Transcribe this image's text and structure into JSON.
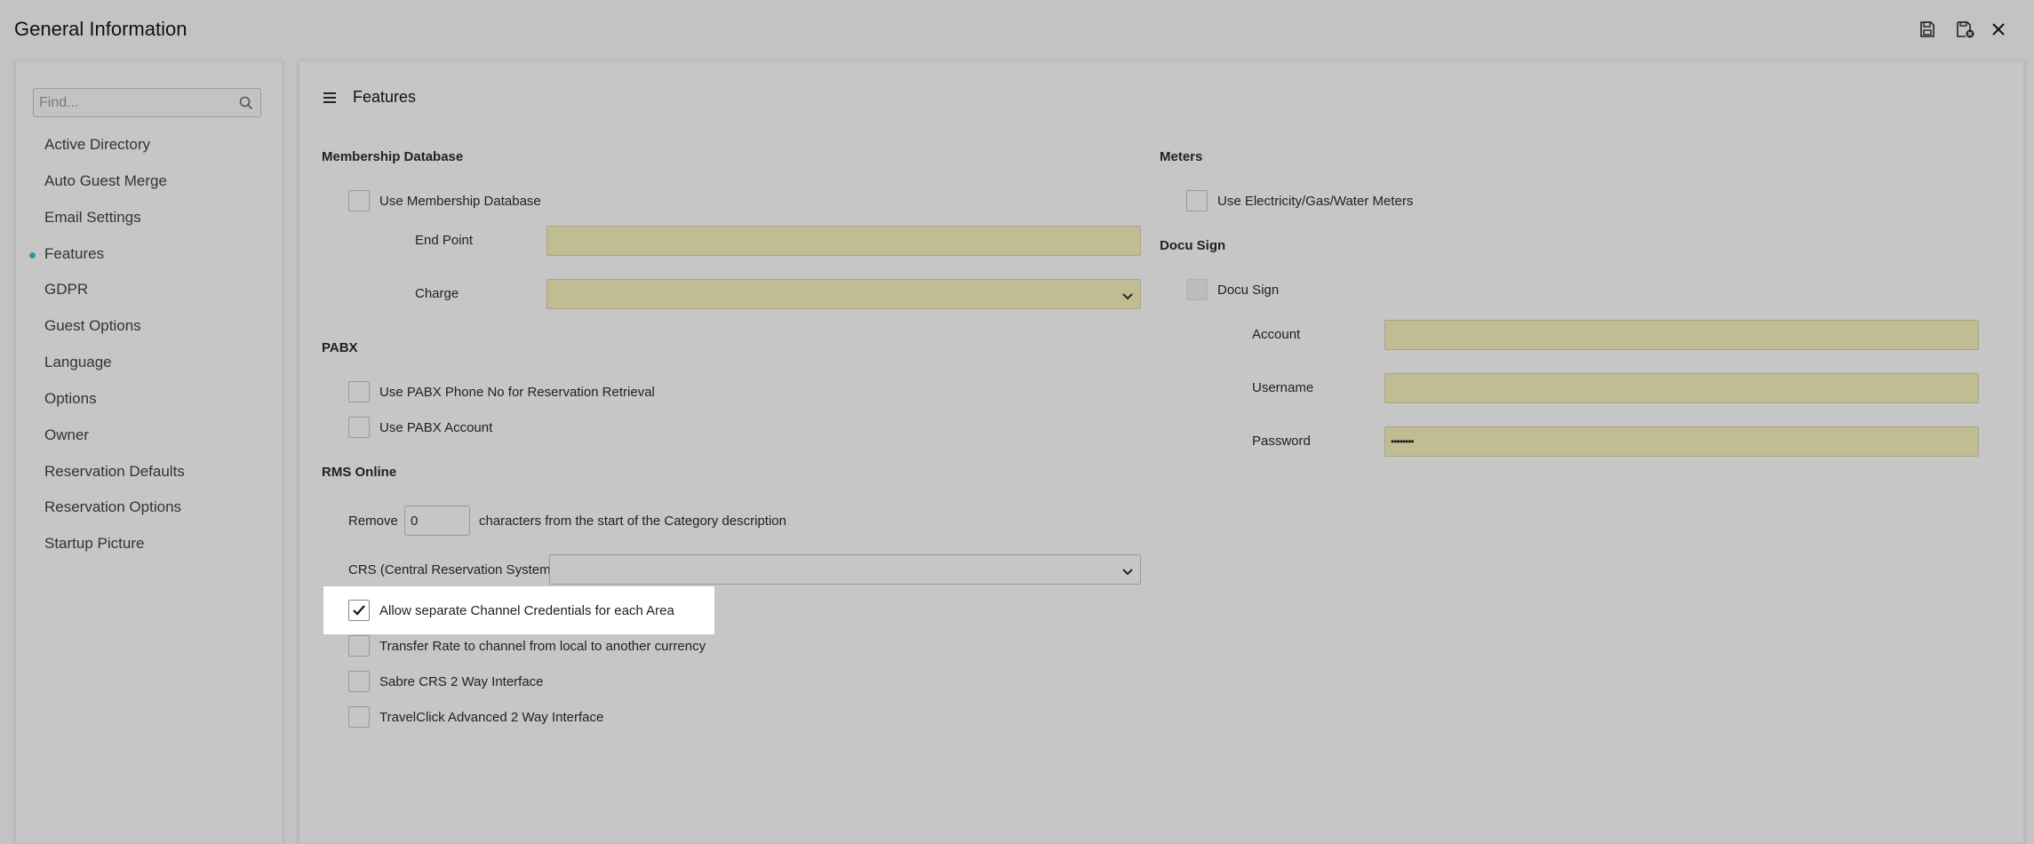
{
  "window": {
    "title": "General Information"
  },
  "toolbar": {
    "save_icon": "save-icon",
    "save_close_icon": "save-close-icon",
    "close_icon": "close-icon"
  },
  "sidebar": {
    "search_placeholder": "Find...",
    "active": "Features",
    "items": [
      "Active Directory",
      "Auto Guest Merge",
      "Email Settings",
      "Features",
      "GDPR",
      "Guest Options",
      "Language",
      "Options",
      "Owner",
      "Reservation Defaults",
      "Reservation Options",
      "Startup Picture"
    ]
  },
  "main": {
    "title": "Features",
    "membership": {
      "heading": "Membership Database",
      "use_label": "Use Membership Database",
      "use_checked": false,
      "end_point_label": "End Point",
      "end_point_value": "",
      "charge_label": "Charge",
      "charge_value": ""
    },
    "pabx": {
      "heading": "PABX",
      "phone_label": "Use PABX Phone No for Reservation Retrieval",
      "phone_checked": false,
      "account_label": "Use PABX Account",
      "account_checked": false
    },
    "rms_online": {
      "heading": "RMS Online",
      "remove_label": "Remove",
      "remove_value": "0",
      "remove_suffix": "characters from the start of the Category description",
      "crs_label": "CRS (Central Reservation System)",
      "crs_value": "",
      "allow_label": "Allow separate Channel Credentials for each Area",
      "allow_checked": true,
      "transfer_label": "Transfer Rate to channel from local to another currency",
      "transfer_checked": false,
      "sabre_label": "Sabre CRS 2 Way Interface",
      "sabre_checked": false,
      "travelclick_label": "TravelClick Advanced 2 Way Interface",
      "travelclick_checked": false
    },
    "meters": {
      "heading": "Meters",
      "use_label": "Use Electricity/Gas/Water Meters",
      "use_checked": false
    },
    "docusign": {
      "heading": "Docu Sign",
      "docusign_label": "Docu Sign",
      "docusign_checked": false,
      "account_label": "Account",
      "account_value": "",
      "username_label": "Username",
      "username_value": "",
      "password_label": "Password",
      "password_value": "••••••••"
    }
  },
  "colors": {
    "accent": "#2a9aa8",
    "field_yellow": "#c1bd93",
    "background": "#c3c3c3"
  }
}
